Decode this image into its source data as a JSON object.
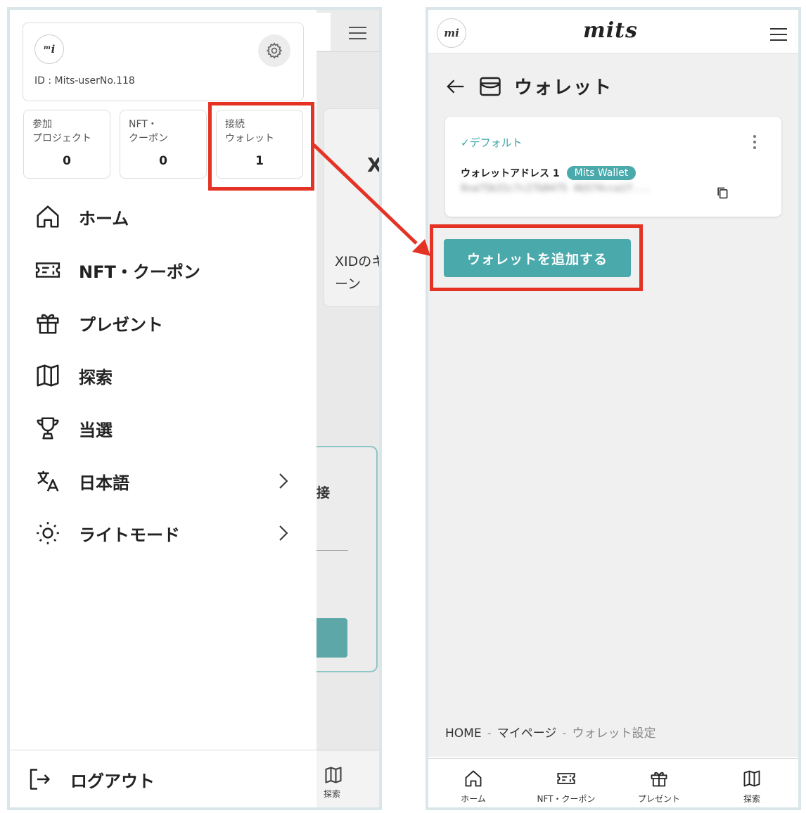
{
  "left": {
    "user_id": "ID : Mits-userNo.118",
    "stats": [
      {
        "label": "参加\nプロジェクト",
        "value": "0"
      },
      {
        "label": "NFT・\nクーポン",
        "value": "0"
      },
      {
        "label": "接続\nウォレット",
        "value": "1"
      }
    ],
    "menu": [
      {
        "label": "ホーム",
        "icon": "home-icon"
      },
      {
        "label": "NFT・クーポン",
        "icon": "ticket-icon"
      },
      {
        "label": "プレゼント",
        "icon": "gift-icon"
      },
      {
        "label": "探索",
        "icon": "map-icon"
      },
      {
        "label": "当選",
        "icon": "trophy-icon"
      },
      {
        "label": "日本語",
        "icon": "translate-icon"
      },
      {
        "label": "ライトモード",
        "icon": "sun-icon"
      }
    ],
    "logout_label": "ログアウト",
    "background": {
      "x_text": "X",
      "card_text": "XIDのキ\nーン",
      "connect_text": "接",
      "tab_label": "探索"
    }
  },
  "right": {
    "logo_text": "mi",
    "brand": "mits",
    "page_title": "ウォレット",
    "wallet": {
      "default_label": "✓デフォルト",
      "address_label": "ウォレットアドレス 1",
      "badge": "Mits Wallet",
      "address": "0xa75b31c7c27b8475 4b574cca1f..."
    },
    "add_button": "ウォレットを追加する",
    "breadcrumb": {
      "home": "HOME",
      "mypage": "マイページ",
      "current": "ウォレット設定",
      "sep": "-"
    },
    "tabs": [
      {
        "label": "ホーム",
        "icon": "home-icon"
      },
      {
        "label": "NFT・クーポン",
        "icon": "ticket-icon"
      },
      {
        "label": "プレゼント",
        "icon": "gift-icon"
      },
      {
        "label": "探索",
        "icon": "map-icon"
      }
    ]
  },
  "colors": {
    "accent": "#4aa9ab",
    "highlight": "#e43325"
  }
}
